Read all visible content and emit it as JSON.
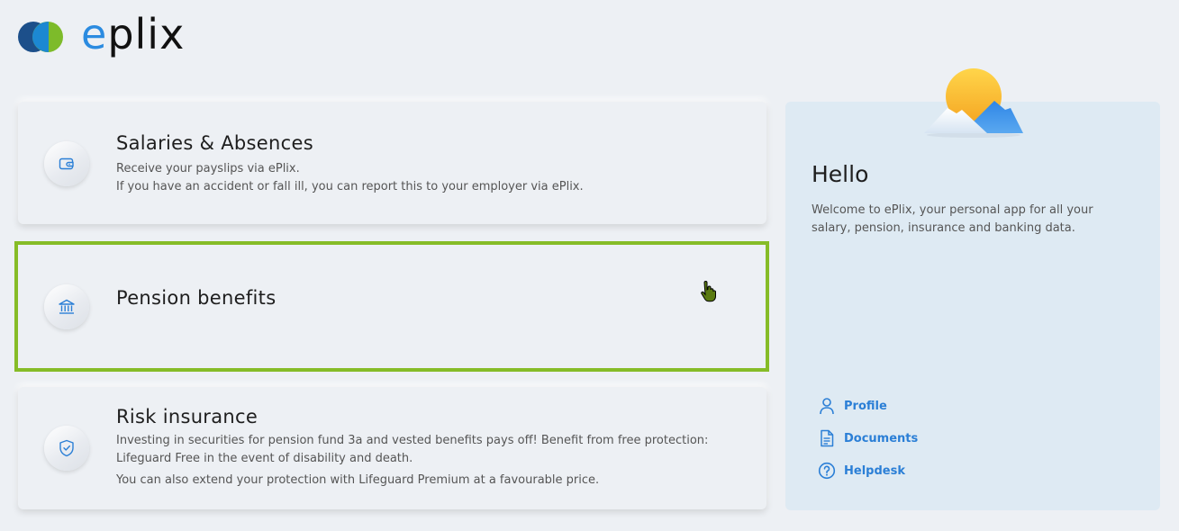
{
  "brand": {
    "name_first": "e",
    "name_rest": "plix"
  },
  "colors": {
    "accent": "#2b7fd6",
    "highlight": "#86bc27"
  },
  "cards": [
    {
      "title": "Salaries & Absences",
      "icon": "wallet-icon",
      "lines": [
        "Receive your payslips via ePlix.",
        "If you have an accident or fall ill, you can report this to your employer via ePlix."
      ]
    },
    {
      "title": "Pension benefits",
      "icon": "bank-icon",
      "lines": []
    },
    {
      "title": "Risk insurance",
      "icon": "shield-check-icon",
      "lines": [
        "Investing in securities for pension fund 3a and vested benefits pays off! Benefit from free protection: Lifeguard Free in the event of disability and death.",
        "You can also extend your protection with Lifeguard Premium at a favourable price."
      ]
    }
  ],
  "panel": {
    "heading": "Hello",
    "welcome": "Welcome to ePlix, your personal app for all your salary, pension, insurance and banking data.",
    "links": [
      {
        "label": "Profile",
        "icon": "user-icon"
      },
      {
        "label": "Documents",
        "icon": "document-icon"
      },
      {
        "label": "Helpdesk",
        "icon": "help-icon"
      }
    ]
  }
}
